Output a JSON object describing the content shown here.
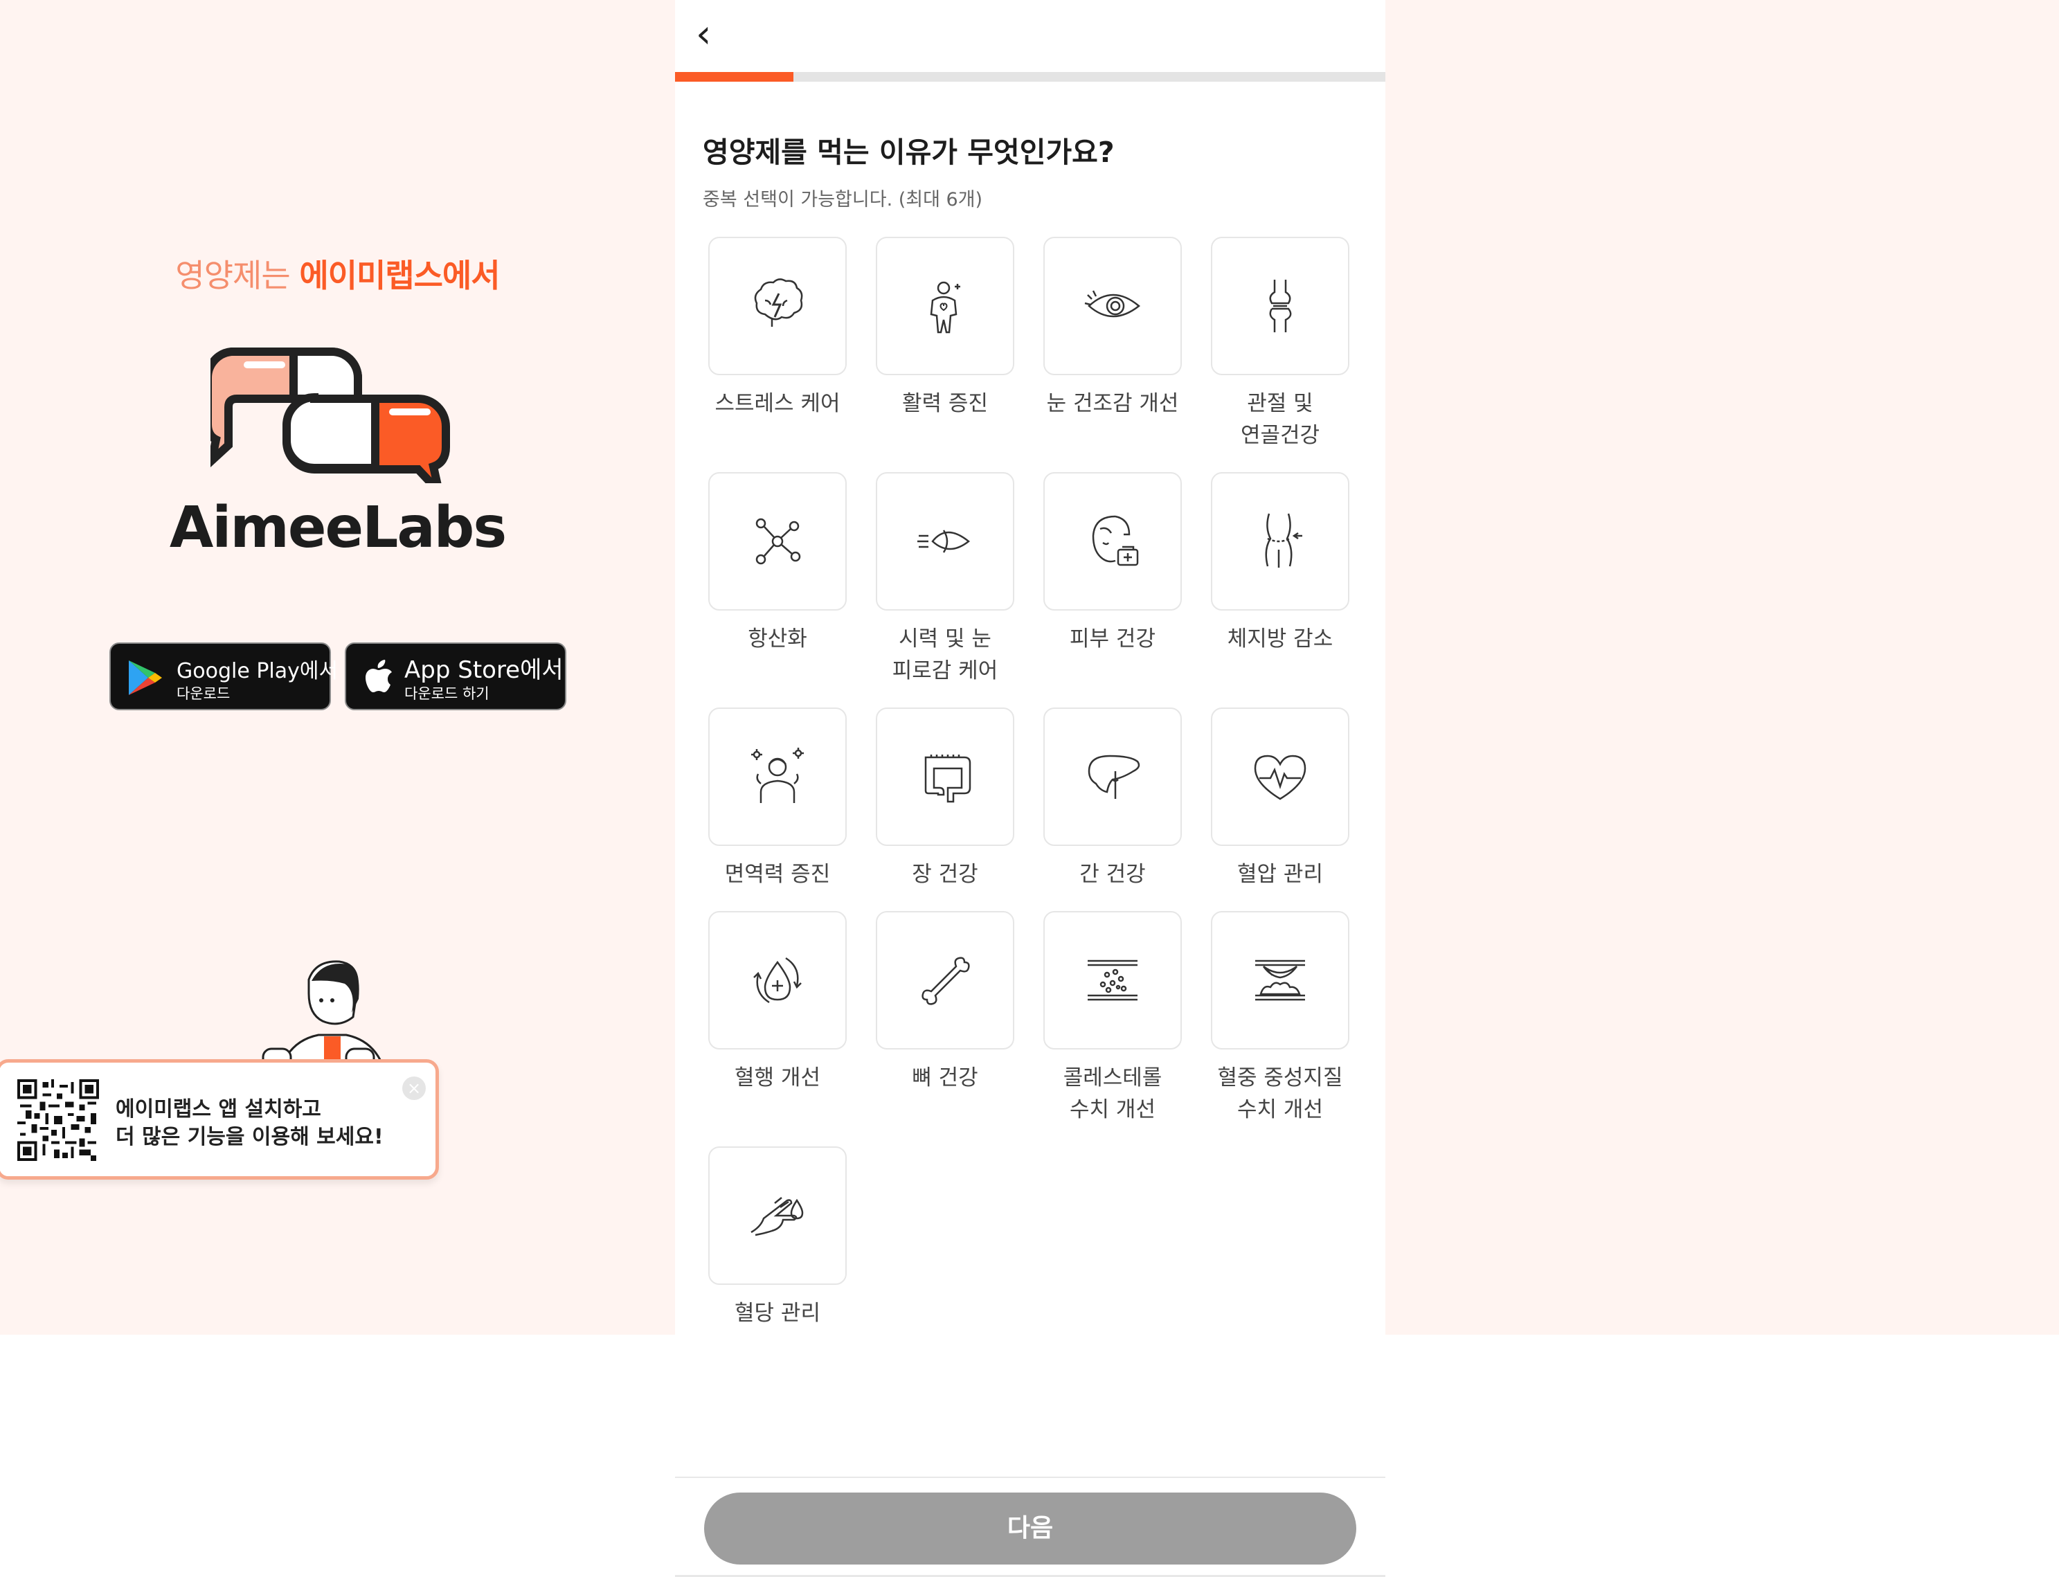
{
  "promo": {
    "tagline_light": "영양제는 ",
    "tagline_bold": "에이미랩스에서",
    "logo_text": "AimeeLabs",
    "google_main": "Google Play에서",
    "google_sub": "다운로드",
    "apple_main": "App Store에서",
    "apple_sub": "다운로드 하기",
    "qr_line1": "에이미랩스 앱 설치하고",
    "qr_line2": "더 많은 기능을 이용해 보세요!",
    "close_symbol": "×"
  },
  "header": {
    "back_symbol": "‹",
    "progress_fraction": 0.167
  },
  "question": {
    "title": "영양제를 먹는 이유가 무엇인가요?",
    "hint": "중복 선택이 가능합니다. (최대 6개)"
  },
  "options": [
    {
      "label": "스트레스 케어",
      "icon": "brain-stress-icon"
    },
    {
      "label": "활력 증진",
      "icon": "person-energy-icon"
    },
    {
      "label": "눈 건조감 개선",
      "icon": "eye-icon"
    },
    {
      "label": "관절 및\n연골건강",
      "icon": "joint-icon"
    },
    {
      "label": "항산화",
      "icon": "molecule-icon"
    },
    {
      "label": "시력 및 눈\n피로감 케어",
      "icon": "eye-strain-icon"
    },
    {
      "label": "피부 건강",
      "icon": "skin-icon"
    },
    {
      "label": "체지방 감소",
      "icon": "waist-icon"
    },
    {
      "label": "면역력 증진",
      "icon": "immune-person-icon"
    },
    {
      "label": "장 건강",
      "icon": "intestine-icon"
    },
    {
      "label": "간 건강",
      "icon": "liver-icon"
    },
    {
      "label": "혈압 관리",
      "icon": "heart-pulse-icon"
    },
    {
      "label": "혈행 개선",
      "icon": "blood-flow-icon"
    },
    {
      "label": "뼈 건강",
      "icon": "bone-icon"
    },
    {
      "label": "콜레스테롤\n수치 개선",
      "icon": "cholesterol-icon"
    },
    {
      "label": "혈중 중성지질\n수치 개선",
      "icon": "triglyceride-icon"
    },
    {
      "label": "혈당 관리",
      "icon": "blood-sugar-icon"
    }
  ],
  "footer": {
    "next_label": "다음"
  },
  "colors": {
    "accent": "#fb5b26",
    "accent_light": "#f58e6d",
    "background_promo": "#fff4f1",
    "button_disabled": "#9e9e9e"
  }
}
